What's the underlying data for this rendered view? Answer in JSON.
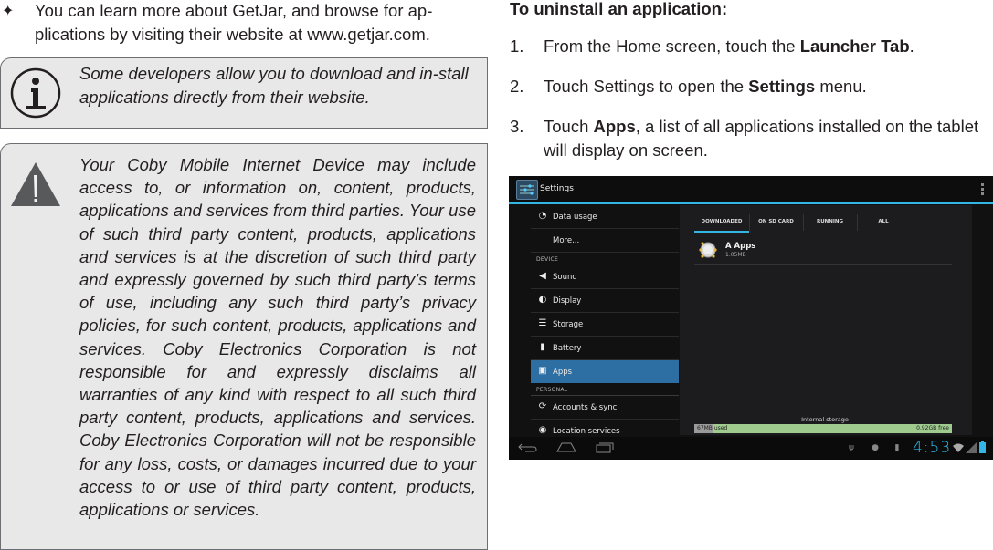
{
  "left_column": {
    "bullet": {
      "icon": "four-point-star",
      "text": "You can learn more about GetJar, and browse for ap-plications by visiting their website at www.getjar.com."
    },
    "info_note": {
      "icon": "info-icon",
      "text": "Some developers allow you to download and in-stall applications directly from their website."
    },
    "warning_note": {
      "icon": "warning-icon",
      "text": "Your Coby Mobile Internet Device may include access to, or information on, content, products, applications and services from third parties. Your use of such third party content, products, applications and services is at the discretion of such third party and expressly governed by such third party’s terms of use, including any such third party’s privacy policies, for such content, products, applications and services. Coby Electronics Corporation is not responsible for and expressly disclaims all warranties of any kind with respect to all such third party content, products, applications and services. Coby Electronics Corporation will not be responsible for any loss, costs, or damages incurred due to your access to or use of third party content, products, applications or services."
    }
  },
  "right_column": {
    "heading": "To uninstall an application:",
    "steps": [
      {
        "num": "1.",
        "pre": "From the Home screen, touch the ",
        "bold": "Launcher Tab",
        "post": "."
      },
      {
        "num": "2.",
        "pre": "Touch Settings to open the ",
        "bold": "Settings",
        "post": " menu."
      },
      {
        "num": "3.",
        "pre": "Touch ",
        "bold": "Apps",
        "post": ", a list of all applications installed on the tablet will display on screen."
      }
    ]
  },
  "tablet": {
    "action_bar": {
      "title": "Settings",
      "icon": "settings-sliders-icon",
      "overflow_icon": "overflow-menu-icon"
    },
    "settings_list": [
      {
        "type": "item",
        "label": "Data usage",
        "icon": "data-usage-icon"
      },
      {
        "type": "item",
        "label": "More...",
        "icon": ""
      },
      {
        "type": "header",
        "label": "DEVICE"
      },
      {
        "type": "item",
        "label": "Sound",
        "icon": "sound-icon"
      },
      {
        "type": "item",
        "label": "Display",
        "icon": "display-icon"
      },
      {
        "type": "item",
        "label": "Storage",
        "icon": "storage-icon"
      },
      {
        "type": "item",
        "label": "Battery",
        "icon": "battery-icon"
      },
      {
        "type": "item",
        "label": "Apps",
        "icon": "apps-icon",
        "active": true
      },
      {
        "type": "header",
        "label": "PERSONAL"
      },
      {
        "type": "item",
        "label": "Accounts & sync",
        "icon": "sync-icon"
      },
      {
        "type": "item",
        "label": "Location services",
        "icon": "location-icon"
      }
    ],
    "tabs": [
      "DOWNLOADED",
      "ON SD CARD",
      "RUNNING",
      "ALL"
    ],
    "selected_tab": "DOWNLOADED",
    "apps": [
      {
        "name": "A Apps",
        "size": "1.05MB"
      }
    ],
    "storage": {
      "label": "Internal storage",
      "used": "67MB used",
      "free": "0.92GB free",
      "used_fraction": 0.07
    },
    "status_bar": {
      "time": "4:53"
    },
    "colors": {
      "accent": "#33b5e5",
      "selected_item": "#2e6fa3",
      "storage_free": "#9fcb8f"
    }
  }
}
